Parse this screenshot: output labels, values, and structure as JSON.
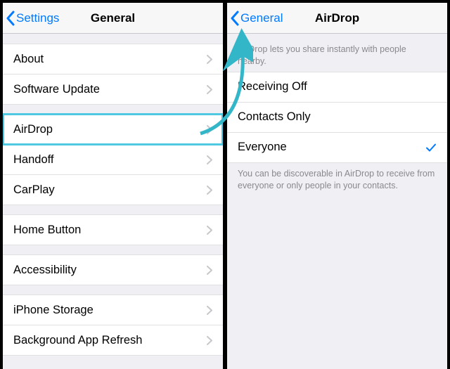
{
  "left": {
    "back_label": "Settings",
    "title": "General",
    "groups": [
      {
        "items": [
          {
            "label": "About"
          },
          {
            "label": "Software Update"
          }
        ]
      },
      {
        "items": [
          {
            "label": "AirDrop",
            "highlighted": true
          },
          {
            "label": "Handoff"
          },
          {
            "label": "CarPlay"
          }
        ]
      },
      {
        "items": [
          {
            "label": "Home Button"
          }
        ]
      },
      {
        "items": [
          {
            "label": "Accessibility"
          }
        ]
      },
      {
        "items": [
          {
            "label": "iPhone Storage"
          },
          {
            "label": "Background App Refresh"
          }
        ]
      }
    ]
  },
  "right": {
    "back_label": "General",
    "title": "AirDrop",
    "header_text": "AirDrop lets you share instantly with people nearby.",
    "options": [
      {
        "label": "Receiving Off",
        "selected": false
      },
      {
        "label": "Contacts Only",
        "selected": false
      },
      {
        "label": "Everyone",
        "selected": true
      }
    ],
    "footer_text": "You can be discoverable in AirDrop to receive from everyone or only people in your contacts."
  },
  "colors": {
    "ios_blue": "#007aff",
    "highlight_teal": "#4fc9e1",
    "bg": "#efeff4"
  }
}
